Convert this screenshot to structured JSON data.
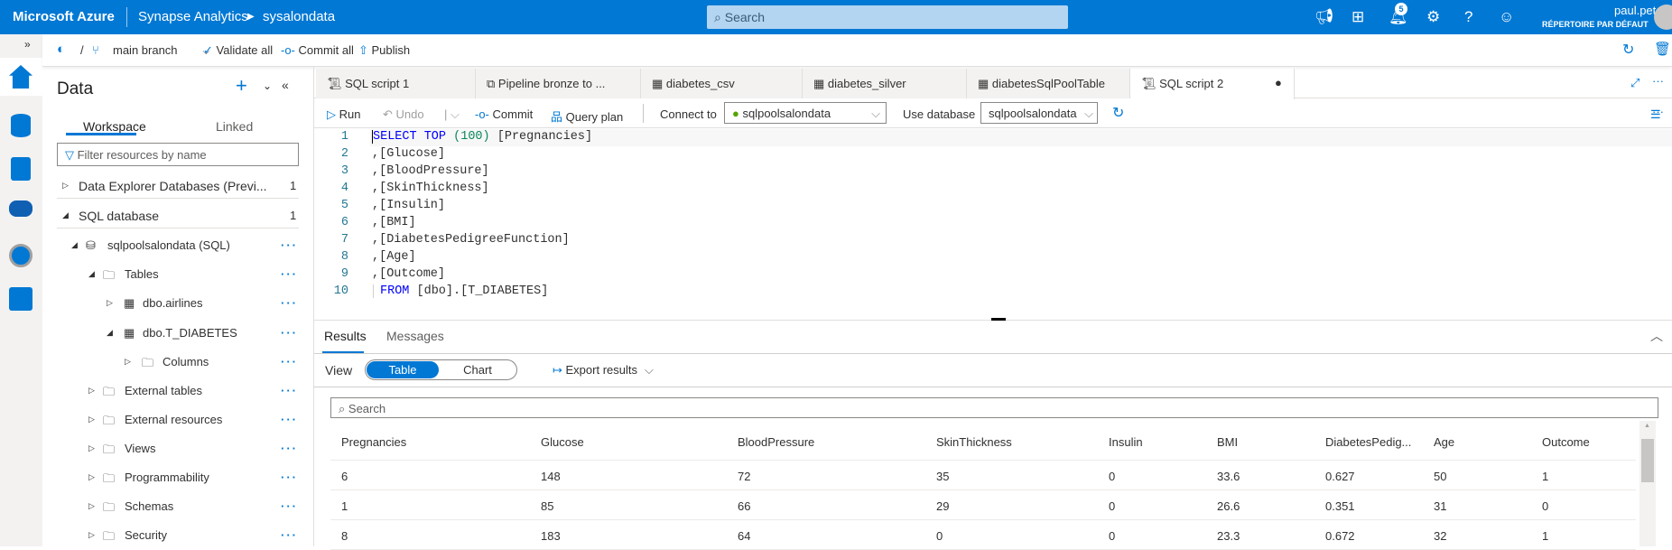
{
  "topbar": {
    "brand": "Microsoft Azure",
    "service": "Synapse Analytics",
    "workspace": "sysalondata",
    "search_placeholder": "Search",
    "notifications": "5",
    "user": "paul.peton@live.fr",
    "directory": "RÉPERTOIRE PAR DÉFAUT",
    "icons": [
      "megaphone-icon",
      "portal-icon",
      "bell-icon",
      "gear-icon",
      "help-icon",
      "feedback-icon"
    ]
  },
  "toolbar": {
    "branch": "main branch",
    "validate": "Validate all",
    "commit": "Commit all",
    "publish": "Publish"
  },
  "panel": {
    "title": "Data",
    "tabs": [
      "Workspace",
      "Linked"
    ],
    "filter_placeholder": "Filter resources by name",
    "sections": [
      {
        "label": "Data Explorer Databases (Previ...",
        "count": "1"
      },
      {
        "label": "SQL database",
        "count": "1"
      }
    ],
    "tree": [
      "sqlpoolsalondata (SQL)",
      "Tables",
      "dbo.airlines",
      "dbo.T_DIABETES",
      "Columns",
      "External tables",
      "External resources",
      "Views",
      "Programmability",
      "Schemas",
      "Security"
    ]
  },
  "tabs": [
    "SQL script 1",
    "Pipeline bronze to ...",
    "diabetes_csv",
    "diabetes_silver",
    "diabetesSqlPoolTable",
    "SQL script 2"
  ],
  "editor_toolbar": {
    "run": "Run",
    "undo": "Undo",
    "commit": "Commit",
    "query_plan": "Query plan",
    "connect_to_label": "Connect to",
    "connect_to": "sqlpoolsalondata",
    "use_db_label": "Use database",
    "use_db": "sqlpoolsalondata"
  },
  "code": {
    "line_numbers": [
      "1",
      "2",
      "3",
      "4",
      "5",
      "6",
      "7",
      "8",
      "9",
      "10"
    ],
    "l1a": "SELECT TOP",
    "l1b": "(100)",
    "l1c": " [Pregnancies]",
    "l2": ",[Glucose]",
    "l3": ",[BloodPressure]",
    "l4": ",[SkinThickness]",
    "l5": ",[Insulin]",
    "l6": ",[BMI]",
    "l7": ",[DiabetesPedigreeFunction]",
    "l8": ",[Age]",
    "l9": ",[Outcome]",
    "l10a": "FROM",
    "l10b": " [dbo].[T_DIABETES]"
  },
  "results": {
    "tabs": [
      "Results",
      "Messages"
    ],
    "view_label": "View",
    "view_options": [
      "Table",
      "Chart"
    ],
    "selected_view": "Table",
    "export": "Export results",
    "search_placeholder": "Search",
    "columns": [
      "Pregnancies",
      "Glucose",
      "BloodPressure",
      "SkinThickness",
      "Insulin",
      "BMI",
      "DiabetesPedig...",
      "Age",
      "Outcome"
    ],
    "rows": [
      [
        "6",
        "148",
        "72",
        "35",
        "0",
        "33.6",
        "0.627",
        "50",
        "1"
      ],
      [
        "1",
        "85",
        "66",
        "29",
        "0",
        "26.6",
        "0.351",
        "31",
        "0"
      ],
      [
        "8",
        "183",
        "64",
        "0",
        "0",
        "23.3",
        "0.672",
        "32",
        "1"
      ]
    ]
  },
  "colors": {
    "accent": "#0078d4",
    "success": "#57a300"
  }
}
